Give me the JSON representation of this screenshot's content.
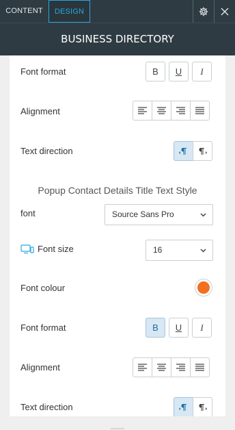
{
  "tabs": {
    "content": "CONTENT",
    "design": "DESIGN"
  },
  "header": {
    "title": "BUSINESS DIRECTORY"
  },
  "section1": {
    "font_format_label": "Font format",
    "alignment_label": "Alignment",
    "text_direction_label": "Text direction"
  },
  "section2": {
    "title": "Popup Contact Details Title Text Style",
    "font_label": "font",
    "font_value": "Source Sans Pro",
    "font_size_label": "Font size",
    "font_size_value": "16",
    "font_colour_label": "Font colour",
    "font_colour_value": "#f36f21",
    "font_format_label": "Font format",
    "alignment_label": "Alignment",
    "text_direction_label": "Text direction"
  },
  "format_buttons": {
    "bold": "B",
    "underline": "U",
    "italic": "I"
  },
  "colors": {
    "accent": "#2aa7df",
    "topbar": "#2f3b42",
    "active_button": "#d7e7f3"
  }
}
